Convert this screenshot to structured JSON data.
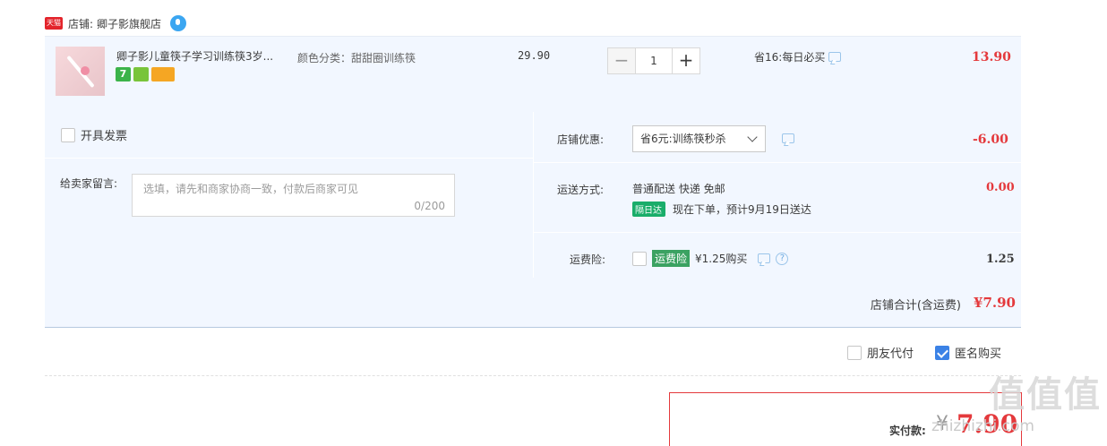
{
  "store": {
    "badge": "天猫",
    "label": "店铺:",
    "name": "卿子影旗舰店"
  },
  "product": {
    "title": "卿子影儿童筷子学习训练筷3岁...",
    "badges": [
      "7",
      "",
      ""
    ],
    "sku": "颜色分类：甜甜圈训练筷",
    "unit_price": "29.90",
    "quantity": "1",
    "minus": "−",
    "plus": "+",
    "promo": "省16:每日必买",
    "total": "13.90"
  },
  "invoice": {
    "label": "开具发票"
  },
  "message": {
    "label": "给卖家留言:",
    "placeholder": "选填，请先和商家协商一致，付款后商家可见",
    "count": "0/200"
  },
  "coupon": {
    "label": "店铺优惠:",
    "selected": "省6元:训练筷秒杀",
    "value": "-6.00"
  },
  "shipping": {
    "label": "运送方式:",
    "method": "普通配送 快递 免邮",
    "tag": "隔日达",
    "eta": "现在下单，预计9月19日送达",
    "value": "0.00"
  },
  "insurance": {
    "label": "运费险:",
    "tag": "运费险",
    "price": "¥1.25购买",
    "value": "1.25"
  },
  "subtotal": {
    "label": "店铺合计(含运费)",
    "value": "¥7.90"
  },
  "payment_options": {
    "friend_pay": "朋友代付",
    "anonymous": "匿名购买",
    "anonymous_checked": true
  },
  "pay": {
    "label": "实付款:",
    "currency": "¥",
    "amount": "7.90"
  },
  "watermark": {
    "main": "值值值",
    "sub": "zhizhizhi.com"
  }
}
